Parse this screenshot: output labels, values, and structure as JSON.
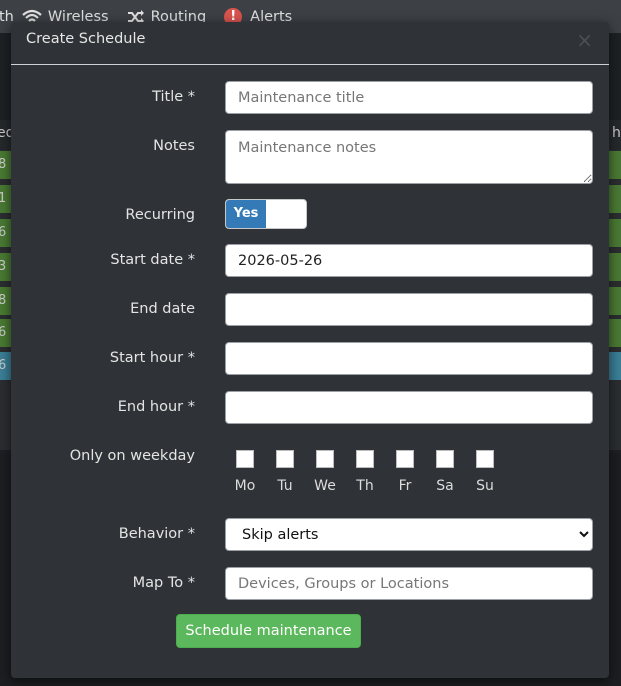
{
  "nav": {
    "partial_left": "th",
    "items": [
      {
        "label": "Wireless",
        "icon": "wifi-icon"
      },
      {
        "label": "Routing",
        "icon": "shuffle-icon"
      },
      {
        "label": "Alerts",
        "icon": "alert-icon",
        "badge": "!"
      }
    ]
  },
  "background_table": {
    "header_left": "ed",
    "header_right": "h",
    "row_left_values": [
      "8",
      "1",
      "6",
      "3",
      "8",
      "6",
      "6"
    ]
  },
  "modal": {
    "title": "Create Schedule",
    "close": "×",
    "form": {
      "title_label": "Title *",
      "title_placeholder": "Maintenance title",
      "notes_label": "Notes",
      "notes_placeholder": "Maintenance notes",
      "recurring_label": "Recurring",
      "recurring_value": "Yes",
      "start_date_label": "Start date *",
      "start_date_value": "2026-05-26",
      "end_date_label": "End date",
      "start_hour_label": "Start hour *",
      "end_hour_label": "End hour *",
      "weekday_label": "Only on weekday",
      "weekdays": [
        "Mo",
        "Tu",
        "We",
        "Th",
        "Fr",
        "Sa",
        "Su"
      ],
      "behavior_label": "Behavior *",
      "behavior_value": "Skip alerts",
      "mapto_label": "Map To *",
      "mapto_placeholder": "Devices, Groups or Locations",
      "submit_label": "Schedule maintenance"
    }
  },
  "colors": {
    "accent_blue": "#337ab7",
    "success_green": "#5cb85c",
    "alert_red": "#d9534f"
  }
}
